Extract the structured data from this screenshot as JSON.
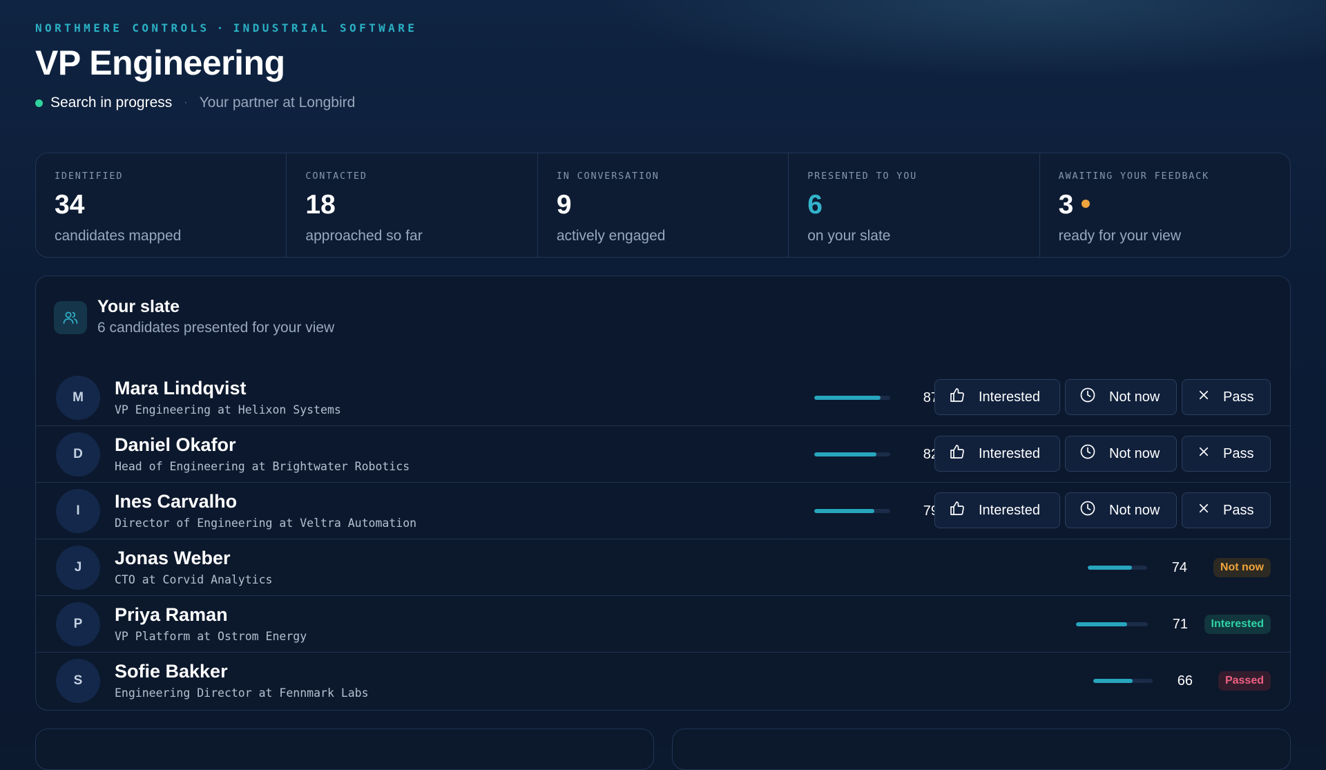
{
  "header": {
    "company": "NORTHMERE CONTROLS",
    "separator": "·",
    "industry": "INDUSTRIAL SOFTWARE",
    "title": "VP Engineering",
    "status": "Search in progress",
    "status_separator": "·",
    "partner": "Your partner at Longbird"
  },
  "stats": [
    {
      "label": "IDENTIFIED",
      "value": "34",
      "sub": "candidates mapped"
    },
    {
      "label": "CONTACTED",
      "value": "18",
      "sub": "approached so far"
    },
    {
      "label": "IN CONVERSATION",
      "value": "9",
      "sub": "actively engaged"
    },
    {
      "label": "PRESENTED TO YOU",
      "value": "6",
      "sub": "on your slate"
    },
    {
      "label": "AWAITING YOUR FEEDBACK",
      "value": "3",
      "sub": "ready for your view"
    }
  ],
  "slate": {
    "title": "Your slate",
    "subtitle": "6 candidates presented for your view",
    "icon": "users-icon"
  },
  "actions": {
    "interested": "Interested",
    "not_now": "Not now",
    "pass": "Pass"
  },
  "candidates": [
    {
      "initial": "M",
      "name": "Mara Lindqvist",
      "role": "VP Engineering at Helixon Systems",
      "score": 87
    },
    {
      "initial": "D",
      "name": "Daniel Okafor",
      "role": "Head of Engineering at Brightwater Robotics",
      "score": 82
    },
    {
      "initial": "I",
      "name": "Ines Carvalho",
      "role": "Director of Engineering at Veltra Automation",
      "score": 79
    },
    {
      "initial": "J",
      "name": "Jonas Weber",
      "role": "CTO at Corvid Analytics",
      "score": 74,
      "status": "Not now"
    },
    {
      "initial": "P",
      "name": "Priya Raman",
      "role": "VP Platform at Ostrom Energy",
      "score": 71,
      "status": "Interested"
    },
    {
      "initial": "S",
      "name": "Sofie Bakker",
      "role": "Engineering Director at Fennmark Labs",
      "score": 66,
      "status": "Passed"
    }
  ],
  "colors": {
    "accent": "#2bb1c4",
    "status_dot": "#2fd39b",
    "feedback_pip": "#f0a43c",
    "not_now": "#f0a43c",
    "interested": "#2fd3a6",
    "passed": "#ef5f82"
  }
}
